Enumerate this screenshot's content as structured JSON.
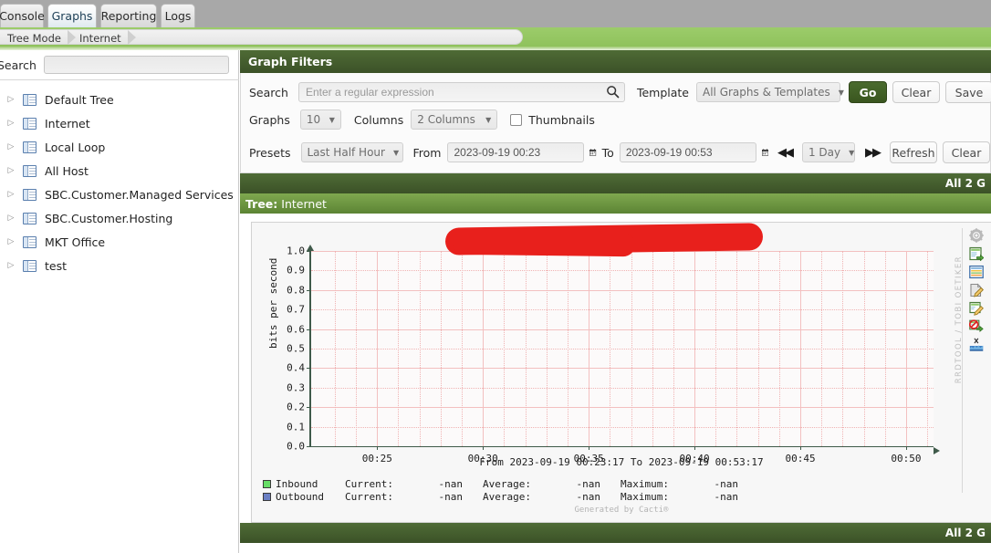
{
  "tabs": [
    {
      "label": "Console",
      "active": false
    },
    {
      "label": "Graphs",
      "active": true
    },
    {
      "label": "Reporting",
      "active": false
    },
    {
      "label": "Logs",
      "active": false
    }
  ],
  "breadcrumb": [
    {
      "label": "Tree Mode"
    },
    {
      "label": "Internet"
    }
  ],
  "sidebar": {
    "search_label": "Search",
    "search_value": "",
    "search_placeholder": "",
    "items": [
      {
        "label": "Default Tree"
      },
      {
        "label": "Internet"
      },
      {
        "label": "Local Loop"
      },
      {
        "label": "All Host"
      },
      {
        "label": "SBC.Customer.Managed Services"
      },
      {
        "label": "SBC.Customer.Hosting"
      },
      {
        "label": "MKT Office"
      },
      {
        "label": "test"
      }
    ],
    "twisty_glyph": "▷"
  },
  "filters": {
    "title": "Graph Filters",
    "search_label": "Search",
    "search_value": "",
    "search_placeholder": "Enter a regular expression",
    "template_label": "Template",
    "template_value": "All Graphs & Templates",
    "go_label": "Go",
    "clear_label": "Clear",
    "save_label": "Save",
    "graphs_label": "Graphs",
    "graphs_value": "10",
    "columns_label": "Columns",
    "columns_value": "2 Columns",
    "thumbnails_label": "Thumbnails",
    "thumbnails_checked": false,
    "presets_label": "Presets",
    "presets_value": "Last Half Hour",
    "from_label": "From",
    "from_value": "2023-09-19 00:23",
    "to_label": "To",
    "to_value": "2023-09-19 00:53",
    "shift_back_glyph": "◀◀",
    "shift_fwd_glyph": "▶▶",
    "shift_value": "1 Day",
    "refresh_label": "Refresh",
    "clear2_label": "Clear"
  },
  "summary": {
    "top_bar": "All 2 G",
    "bottom_bar": "All 2 G",
    "tree_prefix": "Tree:",
    "tree_name": "Internet"
  },
  "chart_data": {
    "type": "line",
    "title": "",
    "title_redacted": true,
    "xlabel": "",
    "ylabel": "bits per second",
    "ylim": [
      0.0,
      1.0
    ],
    "yticks": [
      "0.0",
      "0.1",
      "0.2",
      "0.3",
      "0.4",
      "0.5",
      "0.6",
      "0.7",
      "0.8",
      "0.9",
      "1.0"
    ],
    "xticks": [
      "00:25",
      "00:30",
      "00:35",
      "00:40",
      "00:45",
      "00:50"
    ],
    "grid": true,
    "legend_position": "bottom-left",
    "range_caption": "From 2023-09-19 00:23:17 To 2023-09-19 00:53:17",
    "watermark": "Generated by Cacti®",
    "rrd_watermark": "RRDTOOL / TOBI OETIKER",
    "stat_headers": [
      "Current:",
      "Average:",
      "Maximum:"
    ],
    "series": [
      {
        "name": "Inbound",
        "color": "#66dd66",
        "values": [],
        "current": "-nan",
        "average": "-nan",
        "maximum": "-nan"
      },
      {
        "name": "Outbound",
        "color": "#6b7fc4",
        "values": [],
        "current": "-nan",
        "average": "-nan",
        "maximum": "-nan"
      }
    ]
  },
  "graph_tools": [
    {
      "name": "gear-icon"
    },
    {
      "name": "export-csv-icon"
    },
    {
      "name": "properties-icon"
    },
    {
      "name": "edit-graph-icon"
    },
    {
      "name": "edit-graph-template-icon"
    },
    {
      "name": "disable-debug-icon"
    },
    {
      "name": "realtime-graph-icon"
    }
  ],
  "colors": {
    "accent_green": "#3c5228",
    "tree_bar": "#5c8434",
    "breadcrumb": "#8fc25c",
    "redaction": "#e8201c"
  }
}
